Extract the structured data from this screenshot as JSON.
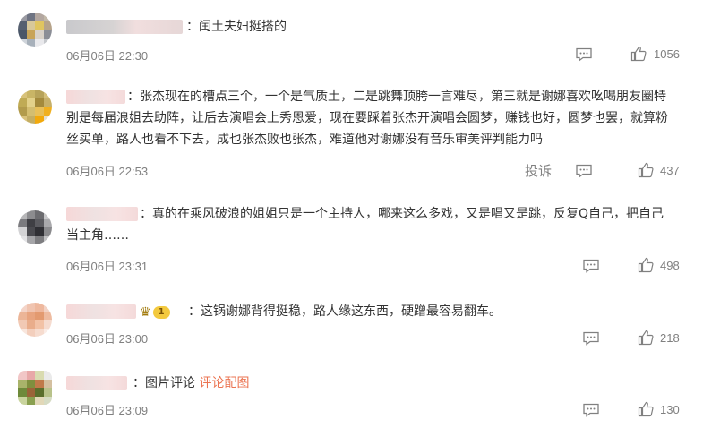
{
  "comments": [
    {
      "text": "闰土夫妇挺搭的",
      "date": "06月06日 22:30",
      "likes": "1056",
      "has_report": false
    },
    {
      "text": "张杰现在的槽点三个，一个是气质土，二是跳舞顶胯一言难尽，第三就是谢娜喜欢吆喝朋友圈特别是每届浪姐去助阵，让后去演唱会上秀恩爱，现在要踩着张杰开演唱会圆梦，赚钱也好，圆梦也罢，就算粉丝买单，路人也看不下去，成也张杰败也张杰，难道他对谢娜没有音乐审美评判能力吗",
      "date": "06月06日 22:53",
      "likes": "437",
      "has_report": true,
      "report_label": "投诉"
    },
    {
      "text": "真的在乘风破浪的姐姐只是一个主持人，哪来这么多戏，又是唱又是跳，反复Q自己，把自己当主角……",
      "date": "06月06日 23:31",
      "likes": "498",
      "has_report": false
    },
    {
      "text": "这锅谢娜背得挺稳，路人缘这东西，硬蹭最容易翻车。",
      "date": "06月06日 23:00",
      "likes": "218",
      "has_report": false,
      "badge_level": "1"
    },
    {
      "text": "图片评论",
      "link": "评论配图",
      "date": "06月06日 23:09",
      "likes": "130",
      "has_report": false
    }
  ],
  "colors": {
    "link": "#eb7350",
    "meta": "#808080",
    "text": "#333333"
  }
}
